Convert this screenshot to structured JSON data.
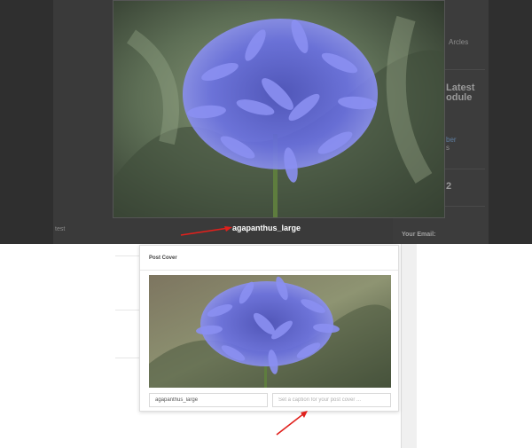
{
  "lightbox": {
    "caption": "agapanthus_large"
  },
  "background_page": {
    "body_text": "test",
    "sidebar": {
      "articles_text": "Arcles",
      "latest_heading_1": "Latest",
      "latest_heading_2": "odule",
      "link_text": "ber",
      "link_sub": "s",
      "number_text": "2",
      "email_label": "Your Email:"
    }
  },
  "post_cover": {
    "title": "Post Cover",
    "image_name_value": "agapanthus_large",
    "caption_placeholder": "Set a caption for your post cover ..."
  },
  "colors": {
    "annotation_arrow": "#e0201c",
    "overlay": "#2f2f2f",
    "flower": "#6a6ee0"
  }
}
